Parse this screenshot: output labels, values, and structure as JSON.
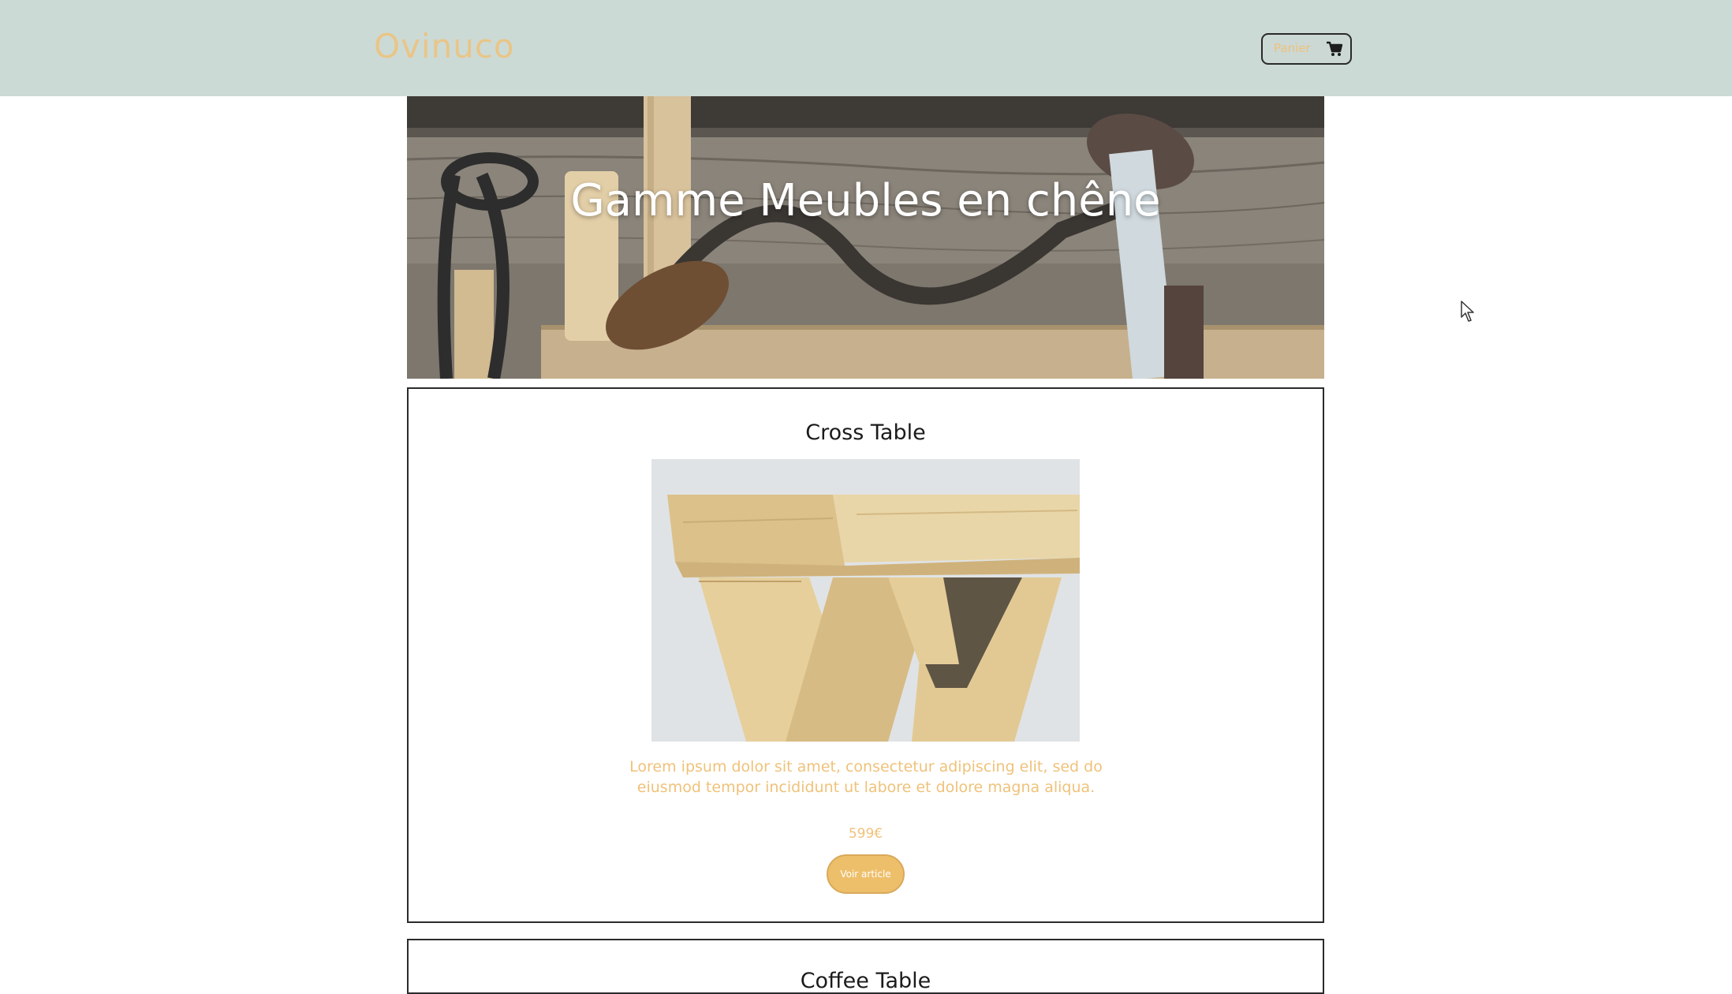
{
  "header": {
    "brand": "Ovinuco",
    "cart_label": "Panier",
    "cart_icon": "shopping-cart-icon"
  },
  "hero": {
    "title": "Gamme Meubles en chêne"
  },
  "products": [
    {
      "title": "Cross Table",
      "description": "Lorem ipsum dolor sit amet, consectetur adipiscing elit, sed do eiusmod tempor incididunt ut labore et dolore magna aliqua.",
      "price": "599€",
      "button_label": "Voir article"
    },
    {
      "title": "Coffee Table"
    }
  ],
  "colors": {
    "header_bg": "#ccdad6",
    "accent": "#efc27a",
    "button_bg": "#eebf6b",
    "card_border": "#2b2b2b"
  }
}
